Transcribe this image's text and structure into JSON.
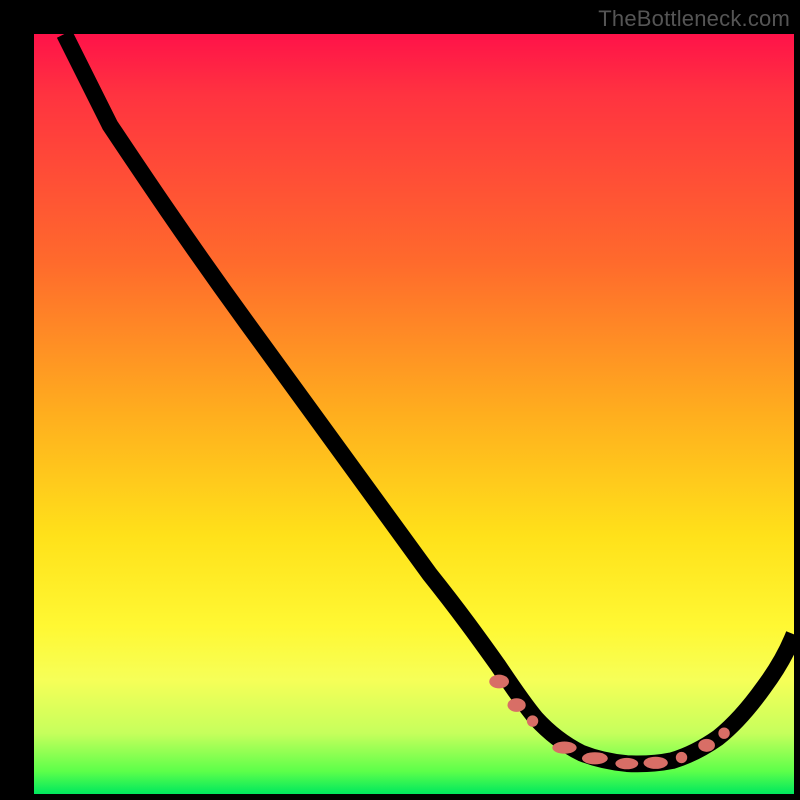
{
  "watermark": "TheBottleneck.com",
  "chart_data": {
    "type": "line",
    "title": "",
    "xlabel": "",
    "ylabel": "",
    "xlim": [
      0,
      100
    ],
    "ylim": [
      0,
      100
    ],
    "grid": false,
    "legend": false,
    "series": [
      {
        "name": "main-curve",
        "x": [
          0,
          3,
          8,
          15,
          25,
          35,
          45,
          55,
          60,
          64,
          68,
          72,
          76,
          80,
          84,
          88,
          92,
          96,
          100
        ],
        "y": [
          100,
          97,
          92,
          84,
          71,
          58,
          45,
          32,
          24,
          17,
          11,
          6,
          3,
          2,
          2,
          4,
          8,
          15,
          23
        ]
      }
    ],
    "annotations": {
      "marker_color": "#d86e66",
      "markers_x": [
        62,
        64,
        66,
        70,
        74,
        78,
        82,
        86,
        88,
        90
      ]
    }
  }
}
